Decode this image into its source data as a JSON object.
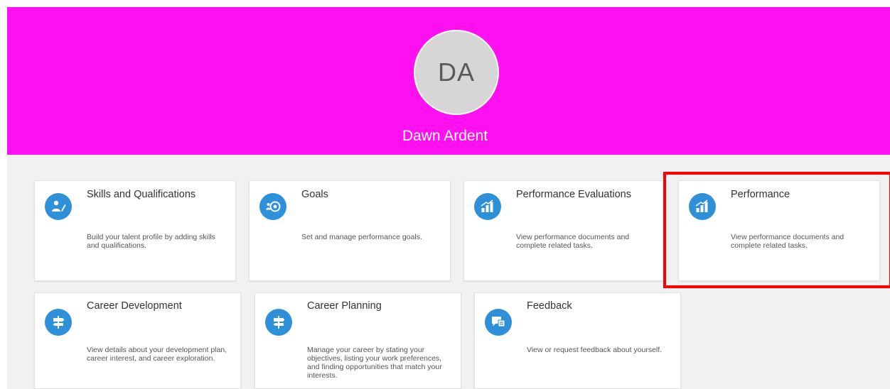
{
  "profile": {
    "initials": "DA",
    "name": "Dawn Ardent"
  },
  "colors": {
    "banner": "#ff10f0",
    "icon_bg": "#2d90d8",
    "highlight": "#ff0000"
  },
  "cards": [
    {
      "title": "Skills and Qualifications",
      "desc": "Build your talent profile by adding skills and qualifications.",
      "icon": "talent-profile-icon"
    },
    {
      "title": "Goals",
      "desc": "Set and manage performance goals.",
      "icon": "goals-target-icon"
    },
    {
      "title": "Performance Evaluations",
      "desc": "View performance documents and complete related tasks.",
      "icon": "bar-chart-icon"
    },
    {
      "title": "Performance",
      "desc": "View performance documents and complete related tasks.",
      "icon": "bar-chart-icon"
    },
    {
      "title": "Career Development",
      "desc": "View details about your development plan, career interest, and career exploration.",
      "icon": "signpost-icon"
    },
    {
      "title": "Career Planning",
      "desc": "Manage your career by stating your objectives, listing your work preferences, and finding opportunities that match your interests.",
      "icon": "signpost-icon"
    },
    {
      "title": "Feedback",
      "desc": "View or request feedback about yourself.",
      "icon": "feedback-icon"
    }
  ]
}
